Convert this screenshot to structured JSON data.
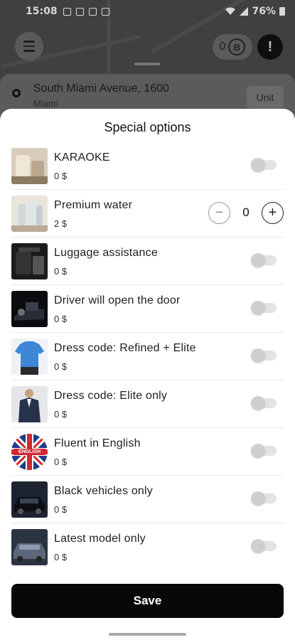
{
  "status_bar": {
    "time": "15:08",
    "battery": "76%"
  },
  "header": {
    "balance": "0",
    "balance_icon": "B",
    "alert_icon": "!"
  },
  "address": {
    "street": "South Miami Avenue, 1600",
    "city": "Miami",
    "unit_label": "Unit"
  },
  "sheet": {
    "title": "Special options",
    "items": [
      {
        "title": "KARAOKE",
        "price": "0 $",
        "control": "toggle",
        "enabled": false,
        "thumb_icon": "karaoke-car-seat-image"
      },
      {
        "title": "Premium water",
        "price": "2 $",
        "control": "stepper",
        "quantity": "0",
        "thumb_icon": "water-bottles-image"
      },
      {
        "title": "Luggage assistance",
        "price": "0 $",
        "control": "toggle",
        "enabled": false,
        "thumb_icon": "luggage-image"
      },
      {
        "title": "Driver will open the door",
        "price": "0 $",
        "control": "toggle",
        "enabled": false,
        "thumb_icon": "car-door-image"
      },
      {
        "title": "Dress code: Refined + Elite",
        "price": "0 $",
        "control": "toggle",
        "enabled": false,
        "thumb_icon": "polo-shirt-image"
      },
      {
        "title": "Dress code: Elite only",
        "price": "0 $",
        "control": "toggle",
        "enabled": false,
        "thumb_icon": "suit-image"
      },
      {
        "title": "Fluent in English",
        "price": "0 $",
        "control": "toggle",
        "enabled": false,
        "thumb_icon": "uk-flag-image",
        "thumb_text": "ENGLISH"
      },
      {
        "title": "Black vehicles only",
        "price": "0 $",
        "control": "toggle",
        "enabled": false,
        "thumb_icon": "black-car-image"
      },
      {
        "title": "Latest model only",
        "price": "0 $",
        "control": "toggle",
        "enabled": false,
        "thumb_icon": "new-car-image"
      }
    ],
    "stepper_minus": "−",
    "stepper_plus": "+",
    "save_label": "Save"
  }
}
